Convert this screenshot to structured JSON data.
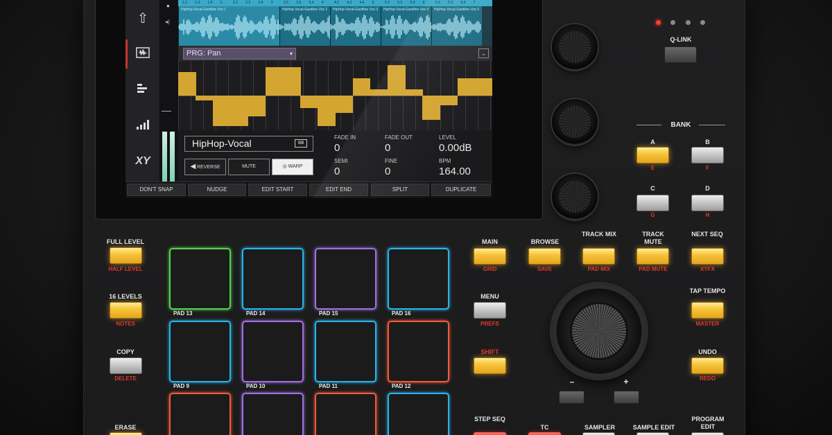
{
  "screen": {
    "sidebar_icons": [
      "up-arrow-icon",
      "waveform-screen-icon",
      "bars-list-icon",
      "level-bars-icon",
      "xy-icon"
    ],
    "ruler_ticks": [
      "1.2",
      "1.3",
      "1.4",
      "2",
      "2.2",
      "2.3",
      "2.4",
      "3",
      "3.2",
      "3.3",
      "3.4",
      "4",
      "4.2",
      "4.3",
      "4.4",
      "5",
      "5.2",
      "5.3",
      "5.4",
      "6",
      "6.2",
      "6.3",
      "6.4",
      "7"
    ],
    "slices": [
      "HipHop-Vocal-Gardline Vox 1",
      "HipHop-Vocal-Gardline Vox 2",
      "HipHop-Vocal-Gardline Vox 3",
      "HipHop-Vocal-Gardline Vox 4",
      "HipHop-Vocal-Gardline Vox 5"
    ],
    "program_selector": "PRG: Pan",
    "automation_levels": [
      0.75,
      -0.15,
      -0.95,
      -0.95,
      -0.65,
      0.9,
      0.9,
      -0.4,
      -0.95,
      -0.55,
      0.55,
      0.2,
      0.95,
      0.2,
      -0.75,
      -0.3,
      0.55,
      0.55
    ],
    "sample_name": "HipHop-Vocal",
    "buttons": {
      "reverse": "REVERSE",
      "mute": "MUTE",
      "warp": "WARP"
    },
    "params": [
      {
        "label": "FADE IN",
        "value": "0"
      },
      {
        "label": "FADE OUT",
        "value": "0"
      },
      {
        "label": "LEVEL",
        "value": "0.00dB"
      },
      {
        "label": "SEMI",
        "value": "0"
      },
      {
        "label": "FINE",
        "value": "0"
      },
      {
        "label": "BPM",
        "value": "164.00"
      }
    ],
    "function_bar": [
      "DON'T SNAP",
      "NUDGE",
      "EDIT START",
      "EDIT END",
      "SPLIT",
      "DUPLICATE"
    ]
  },
  "hardware": {
    "qlink_label": "Q-LINK",
    "bank_label": "BANK",
    "bank_buttons": [
      {
        "label": "A",
        "sub": "E"
      },
      {
        "label": "B",
        "sub": "F"
      },
      {
        "label": "C",
        "sub": "G"
      },
      {
        "label": "D",
        "sub": "H"
      }
    ],
    "left_buttons": [
      {
        "label": "FULL LEVEL",
        "sub": "HALF LEVEL"
      },
      {
        "label": "16 LEVELS",
        "sub": "NOTES"
      },
      {
        "label": "COPY",
        "sub": "DELETE"
      },
      {
        "label": "ERASE",
        "sub": ""
      }
    ],
    "pads": [
      "PAD 13",
      "PAD 14",
      "PAD 15",
      "PAD 16",
      "PAD 9",
      "PAD 10",
      "PAD 11",
      "PAD 12"
    ],
    "mode_buttons": [
      {
        "label": "MAIN",
        "sub": "GRID"
      },
      {
        "label": "BROWSE",
        "sub": "SAVE"
      },
      {
        "label": "TRACK MIX",
        "sub": "PAD MIX"
      },
      {
        "label": "TRACK MUTE",
        "sub": "PAD MUTE"
      },
      {
        "label": "NEXT SEQ",
        "sub": "XYFX"
      }
    ],
    "menu": {
      "label": "MENU",
      "sub": "PREFS"
    },
    "shift": {
      "label": "SHIFT"
    },
    "tap_tempo": {
      "label": "TAP TEMPO",
      "sub": "MASTER"
    },
    "undo": {
      "label": "UNDO",
      "sub": "REDO"
    },
    "minus": "–",
    "plus": "+",
    "bottom_buttons": [
      "STEP SEQ",
      "TC",
      "SAMPLER",
      "SAMPLE EDIT",
      "PROGRAM EDIT"
    ]
  }
}
